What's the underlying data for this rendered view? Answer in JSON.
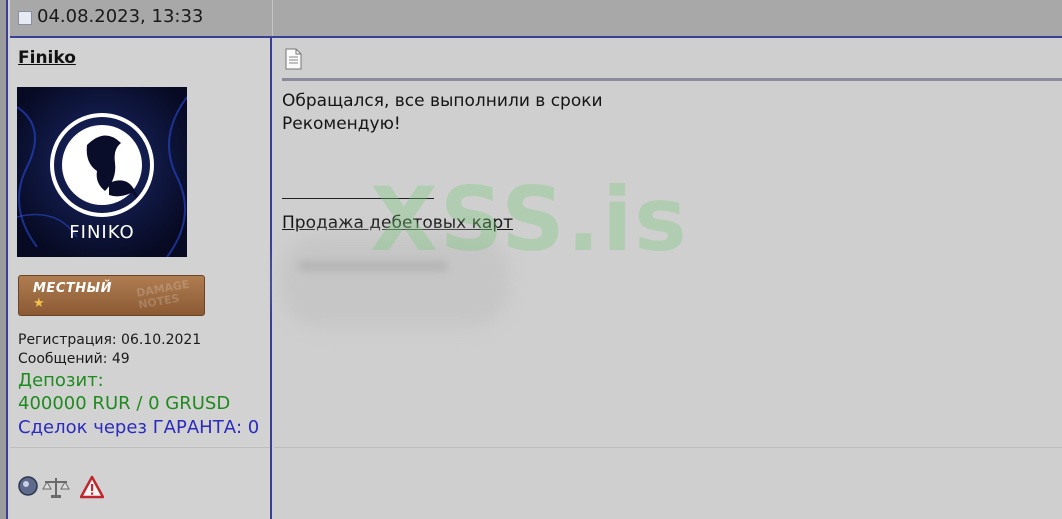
{
  "post": {
    "date": "04.08.2023, 13:33"
  },
  "user": {
    "name": "Finiko",
    "avatar_text": "FINIKO",
    "rank_label": "МЕСТНЫЙ",
    "rank_watermark": "DAMAGE NOTES",
    "registration": "Регистрация: 06.10.2021",
    "messages": "Сообщений: 49",
    "deposit_label": "Депозит:",
    "deposit_value": "400000 RUR / 0 GRUSD",
    "guarantee": "Сделок через ГАРАНТА: 0"
  },
  "message": {
    "lines": [
      "Обращался, все выполнили в сроки",
      "Рекомендую!"
    ],
    "signature_link": "Продажа дебетовых карт"
  },
  "watermark": "XSS.is",
  "icons": [
    "online-status-icon",
    "scales-icon",
    "warning-icon"
  ],
  "colors": {
    "border_accent": "#3a3f94",
    "deposit": "#1f8a1f",
    "guarantee": "#2b2bbf"
  }
}
